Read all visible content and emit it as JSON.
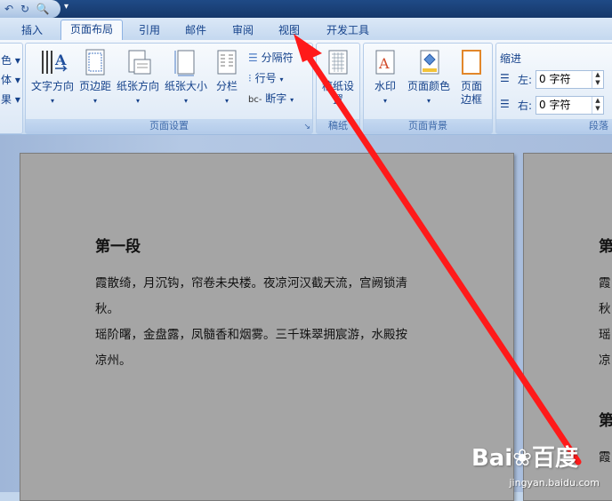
{
  "quick_access": {
    "undo_icon": "undo-icon",
    "preview_icon": "print-preview-icon",
    "more": "▾"
  },
  "tabs": [
    {
      "label": "插入",
      "active": false
    },
    {
      "label": "页面布局",
      "active": true
    },
    {
      "label": "引用",
      "active": false
    },
    {
      "label": "邮件",
      "active": false
    },
    {
      "label": "审阅",
      "active": false
    },
    {
      "label": "视图",
      "active": false
    },
    {
      "label": "开发工具",
      "active": false
    }
  ],
  "ribbon": {
    "left_cut": {
      "items": [
        "色 ▾",
        "体 ▾",
        "果 ▾"
      ]
    },
    "page_setup": {
      "label": "页面设置",
      "text_direction": "文字方向",
      "margins": "页边距",
      "orientation": "纸张方向",
      "size": "纸张大小",
      "columns": "分栏",
      "breaks": "分隔符",
      "line_numbers": "行号",
      "hyphenation": "断字"
    },
    "draft": {
      "label": "稿纸",
      "btn": "稿纸设置"
    },
    "page_background": {
      "label": "页面背景",
      "watermark": "水印",
      "page_color": "页面颜色",
      "page_borders_1": "页面",
      "page_borders_2": "边框"
    },
    "paragraph": {
      "indent_title": "缩进",
      "left_label": "左:",
      "left_value": "0 字符",
      "right_label": "右:",
      "right_value": "0 字符",
      "group_label": "段落"
    }
  },
  "document": {
    "heading": "第一段",
    "line1": "霞散绮，月沉钩，帘卷未央楼。夜凉河汉截天流，宫阙锁清",
    "line2": "秋。",
    "line3": "瑶阶曙，金盘露，凤髓香和烟雾。三千珠翠拥宸游，水殿按",
    "line4": "凉州。",
    "page2_heading": "第",
    "page2_lines": [
      "霞",
      "秋",
      "瑶",
      "凉"
    ],
    "page2_heading2": "第",
    "page2_line5": "霞"
  },
  "watermark": {
    "text": "Bai❀百度",
    "sub": "jingyan.baidu.com"
  },
  "colors": {
    "arrow": "#ff1a1a",
    "page": "#a5a5a5",
    "ribbon_text": "#15428b"
  }
}
